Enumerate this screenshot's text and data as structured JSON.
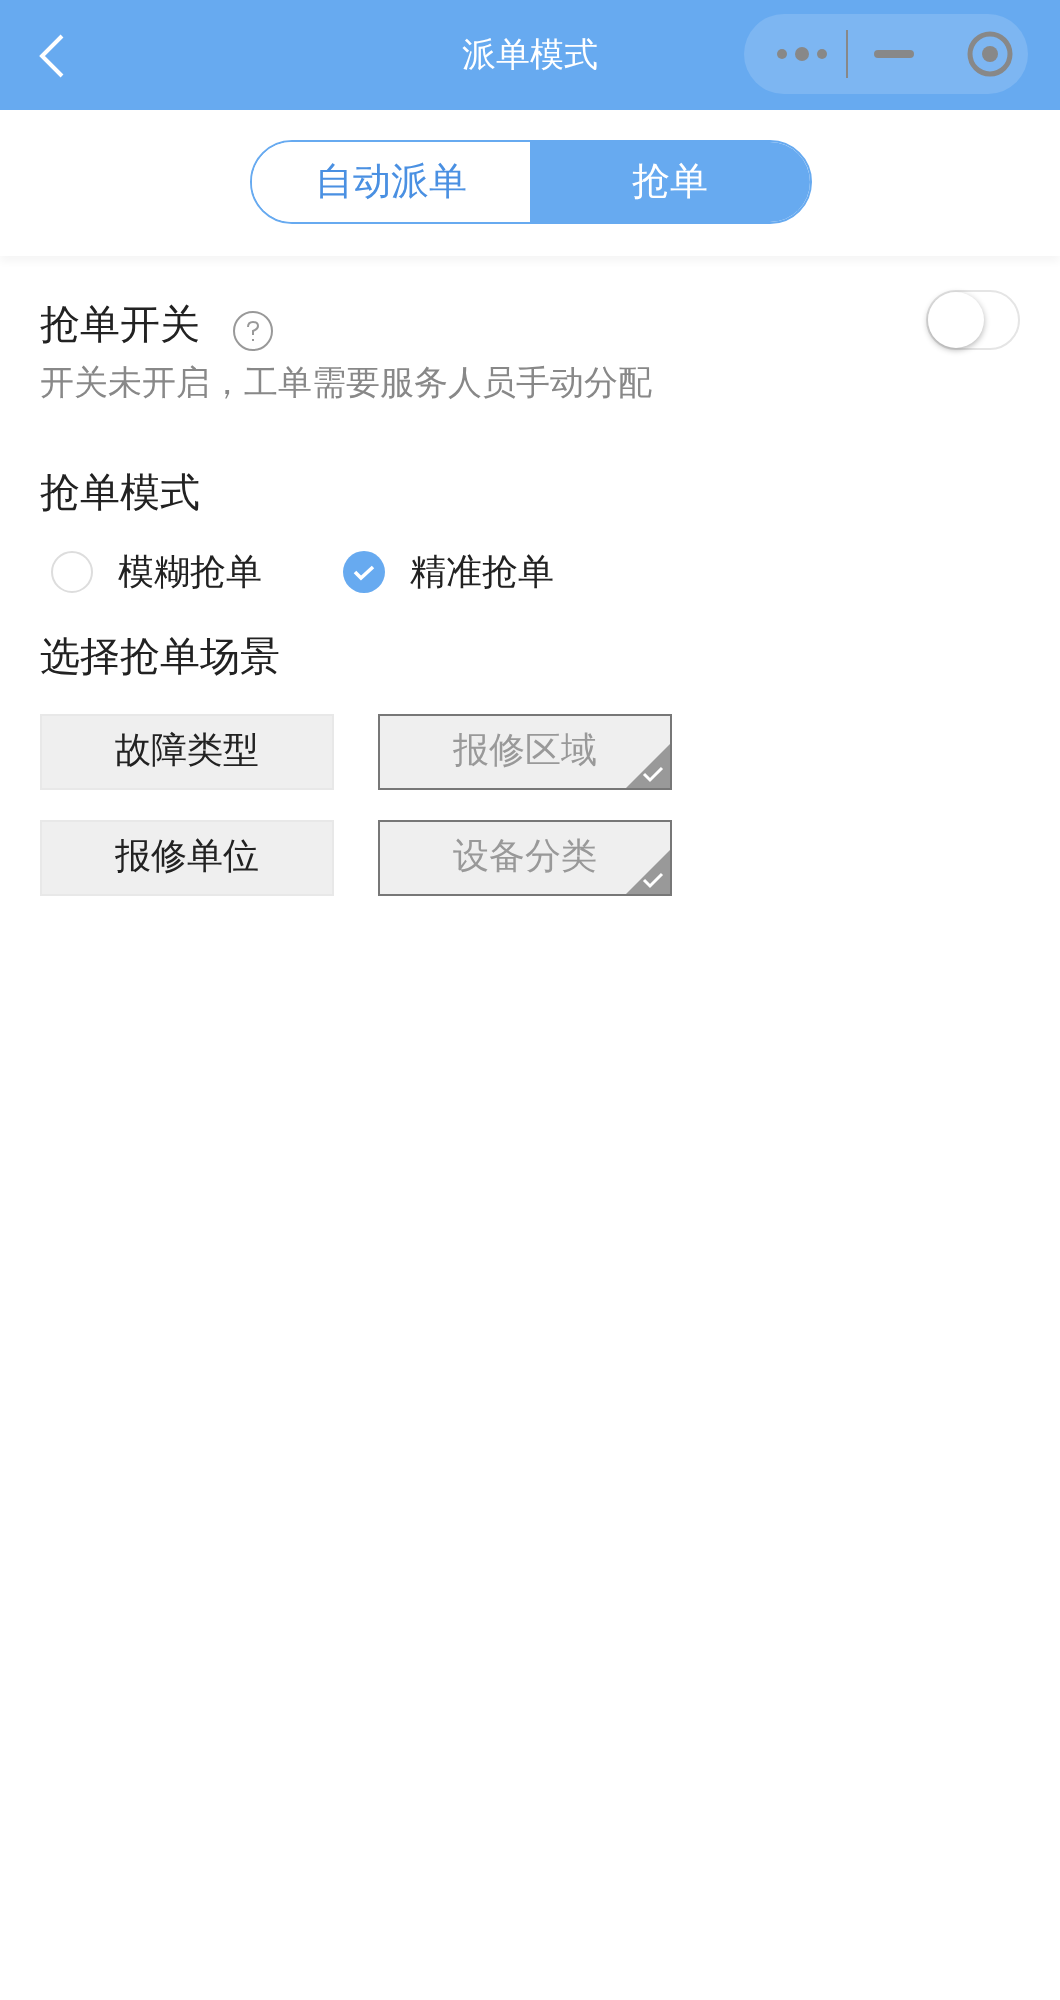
{
  "nav": {
    "title": "派单模式"
  },
  "tabs": [
    {
      "label": "自动派单",
      "selected": false
    },
    {
      "label": "抢单",
      "selected": true
    }
  ],
  "switch_section": {
    "title": "抢单开关",
    "on": false,
    "hint": "开关未开启，工单需要服务人员手动分配"
  },
  "mode_section": {
    "title": "抢单模式",
    "options": [
      {
        "label": "模糊抢单",
        "selected": false
      },
      {
        "label": "精准抢单",
        "selected": true
      }
    ]
  },
  "scene_section": {
    "title": "选择抢单场景",
    "options": [
      {
        "label": "故障类型",
        "selected": false
      },
      {
        "label": "报修区域",
        "selected": true
      },
      {
        "label": "报修单位",
        "selected": false
      },
      {
        "label": "设备分类",
        "selected": true
      }
    ]
  }
}
